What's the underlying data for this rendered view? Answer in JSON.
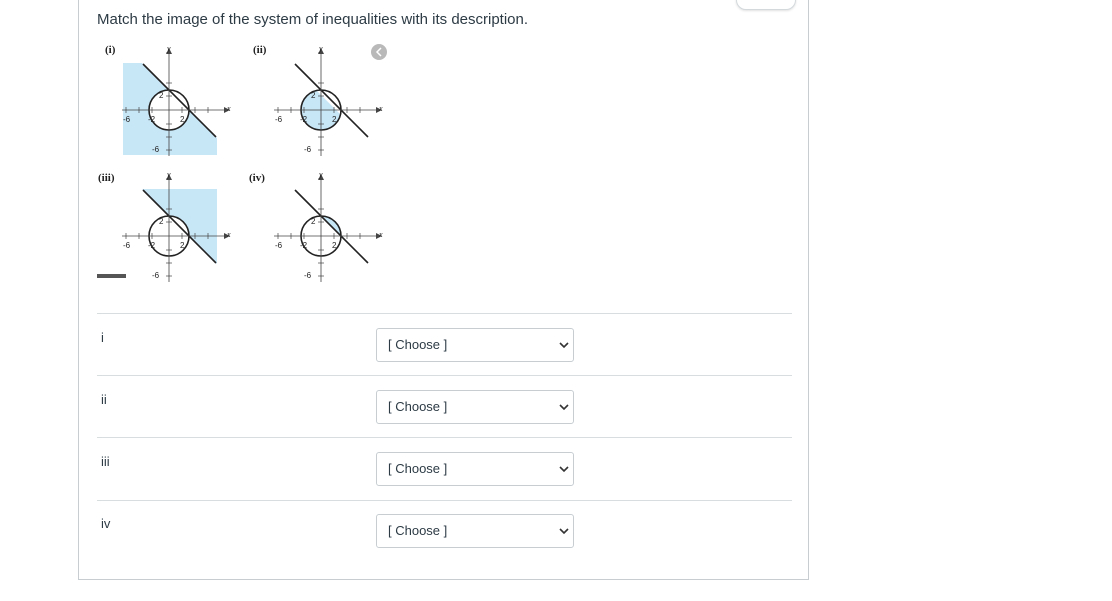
{
  "question": {
    "prompt": "Match the image of the system of inequalities with its description."
  },
  "figures": [
    {
      "label": "(i)",
      "shading": "outside-circle-below-line-rect"
    },
    {
      "label": "(ii)",
      "shading": "inside-circle-below-line"
    },
    {
      "label": "(iii)",
      "shading": "outside-circle-above-line-rect"
    },
    {
      "label": "(iv)",
      "shading": "inside-circle-above-line"
    }
  ],
  "axis": {
    "x_label": "x",
    "y_label": "y",
    "tick_x_neg6": "-6",
    "tick_x_neg2": "-2",
    "tick_x_2": "2",
    "tick_y_2": "2",
    "tick_y_neg6": "-6"
  },
  "colors": {
    "shade": "#c7e6f6",
    "nav": "#b9b9b9"
  },
  "answers": [
    {
      "label": "i",
      "selected": "[ Choose ]"
    },
    {
      "label": "ii",
      "selected": "[ Choose ]"
    },
    {
      "label": "iii",
      "selected": "[ Choose ]"
    },
    {
      "label": "iv",
      "selected": "[ Choose ]"
    }
  ]
}
